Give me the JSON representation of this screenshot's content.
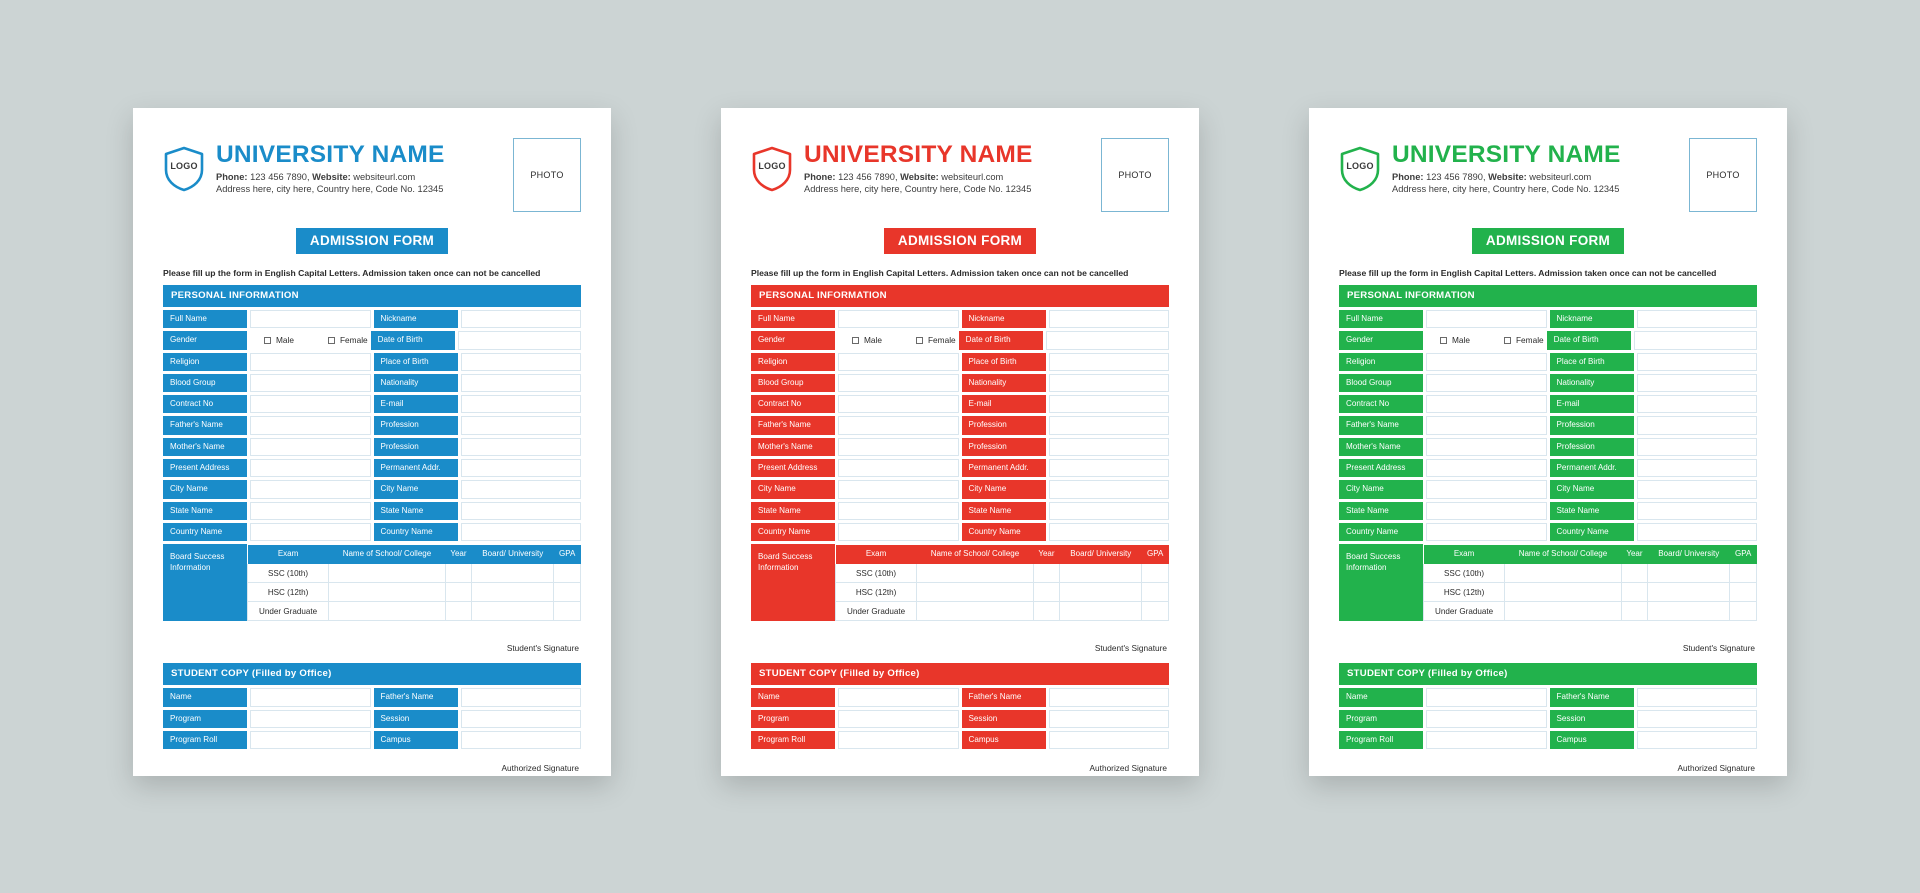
{
  "page": {
    "background_color": "#ccd4d4",
    "card_background": "#ffffff"
  },
  "shared": {
    "logo_text": "LOGO",
    "university_name": "UNIVERSITY NAME",
    "contact_bold": "Phone:",
    "contact_line": "Phone: 123 456 7890, Website: websiteurl.com",
    "address_line": "Address here, city here, Country here, Code No. 12345",
    "photo_label": "PHOTO",
    "form_title": "ADMISSION FORM",
    "notice": "Please fill up the form in English Capital Letters. Admission taken once can not be cancelled",
    "personal_section_title": "PERSONAL INFORMATION",
    "student_section_title": "STUDENT COPY (Filled by Office)",
    "student_signature": "Student's Signature",
    "authorized_signature": "Authorized Signature",
    "gender": {
      "male": "Male",
      "female": "Female"
    },
    "personal_rows": [
      {
        "left": "Full Name",
        "right": "Nickname",
        "type": "text"
      },
      {
        "left": "Gender",
        "right": "Date of Birth",
        "type": "gender"
      },
      {
        "left": "Religion",
        "right": "Place of Birth",
        "type": "text"
      },
      {
        "left": "Blood Group",
        "right": "Nationality",
        "type": "text"
      },
      {
        "left": "Contract No",
        "right": "E-mail",
        "type": "text"
      },
      {
        "left": "Father's Name",
        "right": "Profession",
        "type": "text"
      },
      {
        "left": "Mother's Name",
        "right": "Profession",
        "type": "text"
      },
      {
        "left": "Present Address",
        "right": "Permanent Addr.",
        "type": "text"
      },
      {
        "left": "City  Name",
        "right": "City  Name",
        "type": "text"
      },
      {
        "left": "State Name",
        "right": "State Name",
        "type": "text"
      },
      {
        "left": "Country Name",
        "right": "Country Name",
        "type": "text"
      }
    ],
    "board": {
      "label": "Board Success Information",
      "columns": [
        "Exam",
        "Name of School/ College",
        "Year",
        "Board/ University",
        "GPA"
      ],
      "rows": [
        "SSC (10th)",
        "HSC (12th)",
        "Under Graduate"
      ]
    },
    "student_rows": [
      {
        "left": "Name",
        "right": "Father's Name"
      },
      {
        "left": "Program",
        "right": "Session"
      },
      {
        "left": "Program Roll",
        "right": "Campus"
      }
    ]
  },
  "cards": [
    {
      "id": "blue",
      "accent": "#1a8cc9",
      "theme_class": "c-blue"
    },
    {
      "id": "red",
      "accent": "#e8362a",
      "theme_class": "c-red"
    },
    {
      "id": "green",
      "accent": "#22b24c",
      "theme_class": "c-green"
    }
  ]
}
